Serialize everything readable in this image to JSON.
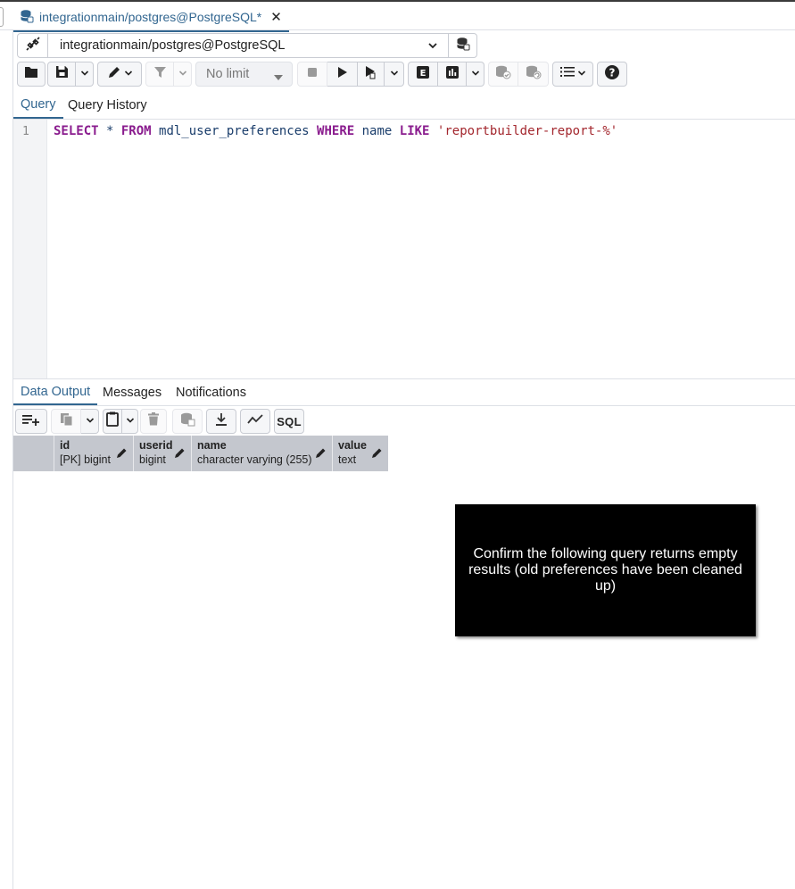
{
  "tab": {
    "title": "integrationmain/postgres@PostgreSQL*",
    "close": "✕"
  },
  "connection": {
    "value": "integrationmain/postgres@PostgreSQL"
  },
  "toolbar": {
    "limit": "No limit"
  },
  "query_tabs": [
    "Query",
    "Query History"
  ],
  "editor": {
    "line_number": "1",
    "tokens": [
      {
        "t": "SELECT",
        "c": "kw"
      },
      {
        "t": " * ",
        "c": "id"
      },
      {
        "t": "FROM",
        "c": "kw"
      },
      {
        "t": " mdl_user_preferences ",
        "c": "id"
      },
      {
        "t": "WHERE",
        "c": "kw"
      },
      {
        "t": " name ",
        "c": "id"
      },
      {
        "t": "LIKE",
        "c": "kw"
      },
      {
        "t": " ",
        "c": "id"
      },
      {
        "t": "'reportbuilder-report-%'",
        "c": "str"
      }
    ]
  },
  "result_tabs": [
    "Data Output",
    "Messages",
    "Notifications"
  ],
  "sql_button": "SQL",
  "columns": [
    {
      "name": "id",
      "type": "[PK] bigint"
    },
    {
      "name": "userid",
      "type": "bigint"
    },
    {
      "name": "name",
      "type": "character varying (255)"
    },
    {
      "name": "value",
      "type": "text"
    }
  ],
  "popup": {
    "text": "Confirm the following query returns empty results (old preferences have been cleaned up)"
  },
  "colors": {
    "accent": "#326690",
    "keyword": "#8a1c8e",
    "string": "#a3262d",
    "header": "#c4c7ce"
  }
}
